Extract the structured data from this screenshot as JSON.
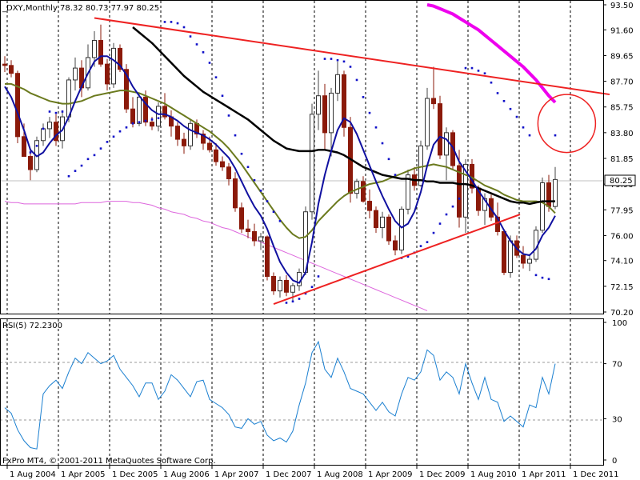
{
  "main_header": "_DXY,Monthly  78.32 80.73 77.97 80.25",
  "sub_header": "RSI(5) 72.2300",
  "footer": "FxPro MT4, © 2001-2011 MetaQuotes Software Corp.",
  "current_price_label": "80.25",
  "colors": {
    "bull": "#ffffff",
    "bear": "#8b1a0a",
    "ma_fast": "#1010a0",
    "ma_mid": "#6b7a1e",
    "ma_slow": "#000000",
    "ma_long": "#dd66dd",
    "ma_top": "#ee00ee",
    "sar": "#1010c8",
    "trend": "#ee2222",
    "rsi": "#1a7fd0",
    "grid": "#000000"
  },
  "chart_data": [
    {
      "type": "candlestick",
      "y_ticks": [
        "93.50",
        "91.60",
        "89.65",
        "87.70",
        "85.75",
        "83.80",
        "81.85",
        "79.90",
        "77.95",
        "76.00",
        "74.10",
        "72.15",
        "70.20"
      ],
      "ylim": [
        70.2,
        93.5
      ],
      "x_ticks": [
        "1 Aug 2004",
        "1 Apr 2005",
        "1 Dec 2005",
        "1 Aug 2006",
        "1 Apr 2007",
        "1 Dec 2007",
        "1 Aug 2008",
        "1 Apr 2009",
        "1 Dec 2009",
        "1 Aug 2010",
        "1 Apr 2011",
        "1 Dec 2011"
      ],
      "x_tick_month_index": [
        0,
        8,
        16,
        24,
        32,
        40,
        48,
        56,
        64,
        72,
        80,
        88
      ],
      "current_price": 80.25,
      "candles": [
        [
          89.0,
          89.6,
          88.4,
          88.9
        ],
        [
          88.9,
          89.3,
          88.0,
          88.3
        ],
        [
          88.3,
          88.5,
          83.0,
          83.5
        ],
        [
          83.5,
          84.5,
          82.0,
          82.0
        ],
        [
          82.0,
          82.5,
          80.2,
          81.0
        ],
        [
          81.0,
          83.5,
          80.8,
          83.2
        ],
        [
          83.2,
          84.5,
          82.8,
          84.1
        ],
        [
          84.1,
          85.0,
          83.4,
          84.6
        ],
        [
          84.6,
          85.2,
          82.8,
          83.2
        ],
        [
          83.2,
          85.5,
          82.6,
          85.0
        ],
        [
          85.0,
          88.0,
          84.6,
          87.8
        ],
        [
          87.8,
          89.5,
          87.0,
          88.7
        ],
        [
          88.7,
          89.3,
          86.5,
          87.2
        ],
        [
          87.2,
          90.5,
          87.0,
          89.5
        ],
        [
          89.5,
          91.5,
          88.8,
          90.8
        ],
        [
          90.8,
          92.0,
          88.8,
          89.0
        ],
        [
          89.0,
          89.4,
          87.0,
          87.5
        ],
        [
          87.5,
          90.6,
          87.2,
          90.2
        ],
        [
          90.2,
          90.5,
          88.4,
          88.6
        ],
        [
          88.6,
          89.0,
          85.3,
          85.6
        ],
        [
          85.6,
          86.5,
          84.2,
          84.5
        ],
        [
          84.5,
          86.8,
          84.3,
          86.5
        ],
        [
          86.5,
          87.0,
          84.3,
          84.6
        ],
        [
          84.6,
          85.0,
          84.0,
          84.3
        ],
        [
          84.3,
          86.1,
          83.9,
          85.8
        ],
        [
          85.8,
          86.8,
          84.8,
          85.0
        ],
        [
          85.0,
          85.5,
          83.5,
          84.3
        ],
        [
          84.3,
          84.6,
          82.8,
          83.3
        ],
        [
          83.3,
          83.8,
          82.2,
          82.8
        ],
        [
          82.8,
          84.8,
          82.5,
          84.5
        ],
        [
          84.5,
          84.8,
          83.4,
          83.7
        ],
        [
          83.7,
          84.0,
          82.5,
          83.0
        ],
        [
          83.0,
          83.5,
          82.3,
          82.5
        ],
        [
          82.5,
          83.0,
          81.3,
          81.6
        ],
        [
          81.6,
          82.0,
          80.9,
          81.2
        ],
        [
          81.2,
          81.5,
          79.8,
          80.3
        ],
        [
          80.3,
          80.8,
          77.8,
          78.1
        ],
        [
          78.1,
          78.5,
          76.2,
          76.5
        ],
        [
          76.5,
          77.2,
          75.8,
          76.3
        ],
        [
          76.3,
          76.9,
          75.2,
          75.6
        ],
        [
          75.6,
          76.2,
          74.9,
          75.9
        ],
        [
          75.9,
          76.0,
          72.6,
          72.9
        ],
        [
          72.9,
          73.2,
          71.5,
          71.8
        ],
        [
          71.8,
          72.9,
          71.3,
          72.6
        ],
        [
          72.6,
          73.0,
          71.4,
          71.7
        ],
        [
          71.7,
          72.4,
          71.0,
          72.2
        ],
        [
          72.2,
          73.5,
          71.8,
          73.2
        ],
        [
          73.2,
          78.2,
          73.0,
          77.8
        ],
        [
          77.8,
          86.0,
          77.2,
          85.2
        ],
        [
          85.2,
          88.5,
          84.0,
          86.6
        ],
        [
          86.6,
          87.5,
          82.5,
          83.8
        ],
        [
          83.8,
          87.2,
          82.0,
          86.8
        ],
        [
          86.8,
          89.2,
          86.2,
          88.2
        ],
        [
          88.2,
          88.5,
          83.5,
          84.2
        ],
        [
          84.2,
          85.0,
          78.5,
          79.2
        ],
        [
          79.2,
          80.3,
          78.8,
          80.1
        ],
        [
          80.1,
          80.5,
          78.5,
          78.6
        ],
        [
          78.6,
          79.5,
          77.3,
          77.9
        ],
        [
          77.9,
          78.2,
          76.2,
          76.6
        ],
        [
          76.6,
          77.8,
          75.8,
          77.4
        ],
        [
          77.4,
          77.6,
          75.3,
          75.6
        ],
        [
          75.6,
          76.0,
          74.5,
          74.9
        ],
        [
          74.9,
          78.2,
          74.6,
          78.0
        ],
        [
          78.0,
          81.0,
          77.6,
          80.6
        ],
        [
          80.6,
          81.2,
          79.4,
          79.8
        ],
        [
          79.8,
          83.2,
          79.7,
          82.8
        ],
        [
          82.8,
          87.2,
          82.5,
          86.4
        ],
        [
          86.4,
          88.8,
          85.6,
          86.0
        ],
        [
          86.0,
          86.6,
          81.8,
          82.1
        ],
        [
          82.1,
          84.2,
          80.2,
          83.8
        ],
        [
          83.8,
          84.0,
          81.0,
          81.3
        ],
        [
          81.3,
          82.5,
          76.6,
          77.4
        ],
        [
          77.4,
          81.8,
          76.2,
          81.4
        ],
        [
          81.4,
          81.8,
          79.2,
          79.6
        ],
        [
          79.6,
          79.8,
          77.5,
          77.9
        ],
        [
          77.9,
          79.2,
          76.8,
          78.8
        ],
        [
          78.8,
          79.1,
          77.1,
          77.4
        ],
        [
          77.4,
          78.5,
          76.0,
          76.3
        ],
        [
          76.3,
          76.5,
          73.0,
          73.2
        ],
        [
          73.2,
          76.0,
          72.8,
          75.6
        ],
        [
          75.6,
          76.0,
          74.3,
          74.5
        ],
        [
          74.5,
          75.2,
          73.5,
          73.9
        ],
        [
          73.9,
          74.6,
          73.3,
          74.2
        ],
        [
          74.2,
          76.7,
          74.0,
          76.4
        ],
        [
          76.4,
          80.4,
          76.2,
          80.0
        ],
        [
          80.0,
          80.6,
          77.8,
          78.2
        ],
        [
          78.2,
          81.2,
          78.0,
          80.25
        ]
      ],
      "ma_fast": [
        87.3,
        86.5,
        85.3,
        84.0,
        82.5,
        82.0,
        82.3,
        83.0,
        83.6,
        84.0,
        85.0,
        86.2,
        87.3,
        88.3,
        89.2,
        89.6,
        89.6,
        89.3,
        88.9,
        88.2,
        87.3,
        86.6,
        86.0,
        85.5,
        85.2,
        85.2,
        85.0,
        84.7,
        84.3,
        84.0,
        83.8,
        83.6,
        83.3,
        82.9,
        82.4,
        81.9,
        81.1,
        80.1,
        79.1,
        78.2,
        77.5,
        76.5,
        75.2,
        74.0,
        73.2,
        72.6,
        72.4,
        73.2,
        75.5,
        78.4,
        80.6,
        82.4,
        84.0,
        84.9,
        84.6,
        83.7,
        82.5,
        81.3,
        80.1,
        79.0,
        78.0,
        77.1,
        76.6,
        76.9,
        77.8,
        79.3,
        81.3,
        82.9,
        83.5,
        83.3,
        82.7,
        81.6,
        80.9,
        80.2,
        79.4,
        78.7,
        78.0,
        77.3,
        76.4,
        75.6,
        75.0,
        74.6,
        74.5,
        75.0,
        76.0,
        76.6,
        77.5
      ],
      "ma_mid": [
        87.5,
        87.5,
        87.3,
        87.1,
        86.8,
        86.6,
        86.4,
        86.2,
        86.1,
        86.0,
        86.0,
        86.1,
        86.2,
        86.4,
        86.6,
        86.7,
        86.8,
        86.9,
        87.0,
        87.0,
        86.9,
        86.8,
        86.6,
        86.4,
        86.2,
        86.0,
        85.7,
        85.4,
        85.1,
        84.8,
        84.5,
        84.2,
        83.9,
        83.5,
        83.1,
        82.6,
        82.0,
        81.4,
        80.7,
        80.0,
        79.3,
        78.6,
        77.9,
        77.2,
        76.6,
        76.1,
        75.8,
        75.9,
        76.4,
        77.1,
        77.6,
        78.1,
        78.6,
        79.0,
        79.3,
        79.5,
        79.7,
        79.9,
        80.0,
        80.1,
        80.3,
        80.5,
        80.7,
        80.9,
        81.1,
        81.2,
        81.3,
        81.4,
        81.3,
        81.2,
        81.0,
        80.8,
        80.6,
        80.4,
        80.1,
        79.8,
        79.6,
        79.4,
        79.1,
        78.9,
        78.7,
        78.6,
        78.6,
        78.6,
        78.5,
        78.2,
        77.7
      ],
      "ma_slow": {
        "start": 20,
        "values": [
          91.8,
          91.4,
          91.0,
          90.6,
          90.1,
          89.6,
          89.1,
          88.6,
          88.1,
          87.7,
          87.3,
          86.9,
          86.6,
          86.3,
          86.0,
          85.7,
          85.4,
          85.1,
          84.8,
          84.4,
          84.0,
          83.6,
          83.2,
          82.9,
          82.6,
          82.5,
          82.4,
          82.4,
          82.4,
          82.5,
          82.5,
          82.4,
          82.3,
          82.1,
          81.8,
          81.5,
          81.2,
          81.0,
          80.8,
          80.6,
          80.5,
          80.4,
          80.3,
          80.3,
          80.2,
          80.2,
          80.1,
          80.1,
          80.0,
          80.0,
          80.0,
          79.9,
          79.9,
          79.8,
          79.6,
          79.4,
          79.2,
          79.0,
          78.8,
          78.6,
          78.5,
          78.5,
          78.4,
          78.5,
          78.6,
          78.6,
          78.6
        ]
      },
      "ma_long": [
        78.6,
        78.5,
        78.5,
        78.4,
        78.4,
        78.4,
        78.4,
        78.4,
        78.4,
        78.4,
        78.4,
        78.4,
        78.5,
        78.5,
        78.5,
        78.5,
        78.6,
        78.6,
        78.6,
        78.6,
        78.5,
        78.5,
        78.4,
        78.3,
        78.1,
        78.0,
        77.8,
        77.7,
        77.6,
        77.4,
        77.3,
        77.1,
        77.0,
        76.8,
        76.6,
        76.5,
        76.3,
        76.1,
        75.9,
        75.7,
        75.5,
        75.3,
        75.1,
        74.9,
        74.7,
        74.5,
        74.3,
        74.1,
        73.9,
        73.7,
        73.5,
        73.3,
        73.1,
        72.9,
        72.7,
        72.5,
        72.3,
        72.1,
        71.9,
        71.7,
        71.5,
        71.3,
        71.1,
        70.9,
        70.7,
        70.5,
        70.3
      ],
      "ma_top": {
        "start": 66,
        "values": [
          93.5,
          93.4,
          93.2,
          93.0,
          92.8,
          92.5,
          92.2,
          91.9,
          91.6,
          91.2,
          90.8,
          90.4,
          90.0,
          89.6,
          89.2,
          88.8,
          88.3,
          87.8,
          87.2,
          86.6,
          86.1
        ]
      },
      "sar": [
        [
          4,
          82.3
        ],
        [
          5,
          82.8
        ],
        [
          6,
          84.1
        ],
        [
          7,
          85.4
        ],
        [
          8,
          85.3
        ],
        [
          9,
          85.4
        ],
        [
          10,
          80.5
        ],
        [
          11,
          80.9
        ],
        [
          12,
          81.3
        ],
        [
          13,
          81.8
        ],
        [
          14,
          82.1
        ],
        [
          15,
          82.6
        ],
        [
          16,
          83.1
        ],
        [
          17,
          83.5
        ],
        [
          18,
          83.9
        ],
        [
          19,
          84.2
        ],
        [
          20,
          84.5
        ],
        [
          21,
          84.6
        ],
        [
          22,
          84.7
        ],
        [
          23,
          84.8
        ],
        [
          24,
          84.9
        ],
        [
          25,
          92.2
        ],
        [
          26,
          92.2
        ],
        [
          27,
          92.1
        ],
        [
          28,
          91.8
        ],
        [
          29,
          91.1
        ],
        [
          30,
          90.5
        ],
        [
          31,
          89.9
        ],
        [
          32,
          89.1
        ],
        [
          33,
          88.0
        ],
        [
          34,
          86.6
        ],
        [
          35,
          85.1
        ],
        [
          36,
          83.6
        ],
        [
          37,
          82.2
        ],
        [
          38,
          81.2
        ],
        [
          39,
          80.2
        ],
        [
          40,
          79.4
        ],
        [
          41,
          78.6
        ],
        [
          42,
          77.8
        ],
        [
          43,
          77.1
        ],
        [
          44,
          70.9
        ],
        [
          45,
          71.0
        ],
        [
          46,
          71.2
        ],
        [
          47,
          71.6
        ],
        [
          48,
          72.1
        ],
        [
          49,
          72.9
        ],
        [
          50,
          89.4
        ],
        [
          51,
          89.4
        ],
        [
          52,
          89.3
        ],
        [
          53,
          89.2
        ],
        [
          54,
          88.8
        ],
        [
          55,
          87.8
        ],
        [
          56,
          86.5
        ],
        [
          57,
          85.3
        ],
        [
          58,
          84.2
        ],
        [
          59,
          83.0
        ],
        [
          60,
          81.8
        ],
        [
          61,
          80.6
        ],
        [
          62,
          74.3
        ],
        [
          63,
          74.4
        ],
        [
          64,
          74.7
        ],
        [
          65,
          75.2
        ],
        [
          66,
          75.5
        ],
        [
          67,
          76.2
        ],
        [
          68,
          76.9
        ],
        [
          69,
          77.6
        ],
        [
          70,
          78.2
        ],
        [
          71,
          78.8
        ],
        [
          72,
          88.7
        ],
        [
          73,
          88.7
        ],
        [
          74,
          88.5
        ],
        [
          75,
          88.3
        ],
        [
          76,
          87.6
        ],
        [
          77,
          86.8
        ],
        [
          78,
          86.2
        ],
        [
          79,
          85.6
        ],
        [
          80,
          85.0
        ],
        [
          81,
          84.2
        ],
        [
          82,
          83.6
        ],
        [
          83,
          73.0
        ],
        [
          84,
          72.8
        ],
        [
          85,
          72.7
        ],
        [
          86,
          83.6
        ]
      ],
      "trendlines": [
        {
          "x1": 14.0,
          "y1": 92.5,
          "x2": 94.5,
          "y2": 86.7
        },
        {
          "x1": 42.0,
          "y1": 70.8,
          "x2": 80.5,
          "y2": 77.6
        }
      ],
      "circle": {
        "cx": 87.8,
        "cy": 84.5,
        "rx": 4.5,
        "ry": 2.2
      }
    },
    {
      "type": "line",
      "title": "RSI(5) 72.2300",
      "y_ticks": [
        "100",
        "70",
        "30",
        "0"
      ],
      "ylim": [
        0,
        100
      ],
      "levels": [
        70,
        30
      ],
      "values": [
        38,
        34,
        22,
        14,
        9,
        8,
        48,
        54,
        58,
        52,
        64,
        74,
        70,
        78,
        74,
        70,
        72,
        76,
        66,
        60,
        54,
        46,
        56,
        56,
        44,
        50,
        62,
        58,
        52,
        46,
        57,
        58,
        44,
        41,
        38,
        33,
        24,
        23,
        30,
        26,
        28,
        18,
        14,
        16,
        13,
        21,
        40,
        56,
        78,
        86,
        66,
        60,
        74,
        64,
        52,
        50,
        48,
        42,
        36,
        42,
        35,
        32,
        48,
        60,
        58,
        64,
        80,
        76,
        58,
        64,
        60,
        48,
        70,
        56,
        44,
        60,
        44,
        42,
        28,
        32,
        28,
        24,
        40,
        38,
        60,
        48,
        70
      ]
    }
  ]
}
